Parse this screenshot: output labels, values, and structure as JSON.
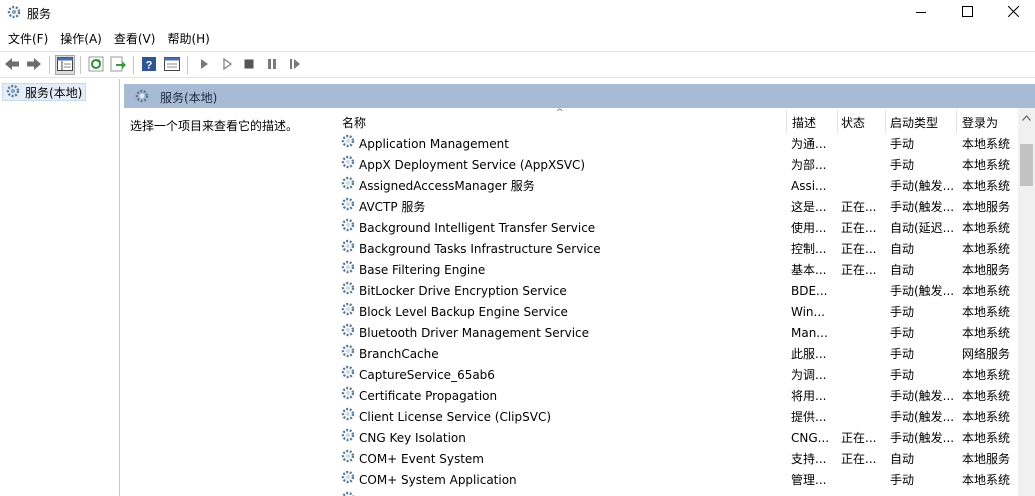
{
  "window": {
    "title": "服务",
    "icons": {
      "app": "gear-icon",
      "minimize": "minimize-icon",
      "maximize": "maximize-icon",
      "close": "close-icon"
    }
  },
  "menu": [
    "文件(F)",
    "操作(A)",
    "查看(V)",
    "帮助(H)"
  ],
  "toolbar": [
    "back-arrow-icon",
    "forward-arrow-icon",
    "show-hide-console-tree-icon",
    "refresh-icon",
    "export-list-icon",
    "help-icon",
    "properties-icon",
    "start-service-icon",
    "start-service-alt-icon",
    "stop-service-icon",
    "pause-service-icon",
    "resume-service-icon"
  ],
  "tree": {
    "root_label": "服务(本地)"
  },
  "pane": {
    "title": "服务(本地)",
    "description_hint": "选择一个项目来查看它的描述。"
  },
  "columns": {
    "name": "名称",
    "description": "描述",
    "status": "状态",
    "startup_type": "启动类型",
    "logon_as": "登录为"
  },
  "services": [
    {
      "name": "Application Management",
      "description": "为通...",
      "status": "",
      "startup_type": "手动",
      "logon_as": "本地系统"
    },
    {
      "name": "AppX Deployment Service (AppXSVC)",
      "description": "为部...",
      "status": "",
      "startup_type": "手动",
      "logon_as": "本地系统"
    },
    {
      "name": "AssignedAccessManager 服务",
      "description": "Assi...",
      "status": "",
      "startup_type": "手动(触发...",
      "logon_as": "本地系统"
    },
    {
      "name": "AVCTP 服务",
      "description": "这是...",
      "status": "正在...",
      "startup_type": "手动(触发...",
      "logon_as": "本地服务"
    },
    {
      "name": "Background Intelligent Transfer Service",
      "description": "使用...",
      "status": "正在...",
      "startup_type": "自动(延迟...",
      "logon_as": "本地系统"
    },
    {
      "name": "Background Tasks Infrastructure Service",
      "description": "控制...",
      "status": "正在...",
      "startup_type": "自动",
      "logon_as": "本地系统"
    },
    {
      "name": "Base Filtering Engine",
      "description": "基本...",
      "status": "正在...",
      "startup_type": "自动",
      "logon_as": "本地服务"
    },
    {
      "name": "BitLocker Drive Encryption Service",
      "description": "BDE...",
      "status": "",
      "startup_type": "手动(触发...",
      "logon_as": "本地系统"
    },
    {
      "name": "Block Level Backup Engine Service",
      "description": "Win...",
      "status": "",
      "startup_type": "手动",
      "logon_as": "本地系统"
    },
    {
      "name": "Bluetooth Driver Management Service",
      "description": "Man...",
      "status": "",
      "startup_type": "手动",
      "logon_as": "本地系统"
    },
    {
      "name": "BranchCache",
      "description": "此服...",
      "status": "",
      "startup_type": "手动",
      "logon_as": "网络服务"
    },
    {
      "name": "CaptureService_65ab6",
      "description": "为调...",
      "status": "",
      "startup_type": "手动",
      "logon_as": "本地系统"
    },
    {
      "name": "Certificate Propagation",
      "description": "将用...",
      "status": "",
      "startup_type": "手动(触发...",
      "logon_as": "本地系统"
    },
    {
      "name": "Client License Service (ClipSVC)",
      "description": "提供...",
      "status": "",
      "startup_type": "手动(触发...",
      "logon_as": "本地系统"
    },
    {
      "name": "CNG Key Isolation",
      "description": "CNG...",
      "status": "正在...",
      "startup_type": "手动(触发...",
      "logon_as": "本地系统"
    },
    {
      "name": "COM+ Event System",
      "description": "支持...",
      "status": "正在...",
      "startup_type": "自动",
      "logon_as": "本地服务"
    },
    {
      "name": "COM+ System Application",
      "description": "管理...",
      "status": "",
      "startup_type": "手动",
      "logon_as": "本地系统"
    },
    {
      "name": "",
      "description": "",
      "status": "",
      "startup_type": "",
      "logon_as": ""
    }
  ],
  "colors": {
    "pane_header": "#a7bbd4",
    "tree_selected": "#e5eef8",
    "gear": "#5a7894"
  }
}
